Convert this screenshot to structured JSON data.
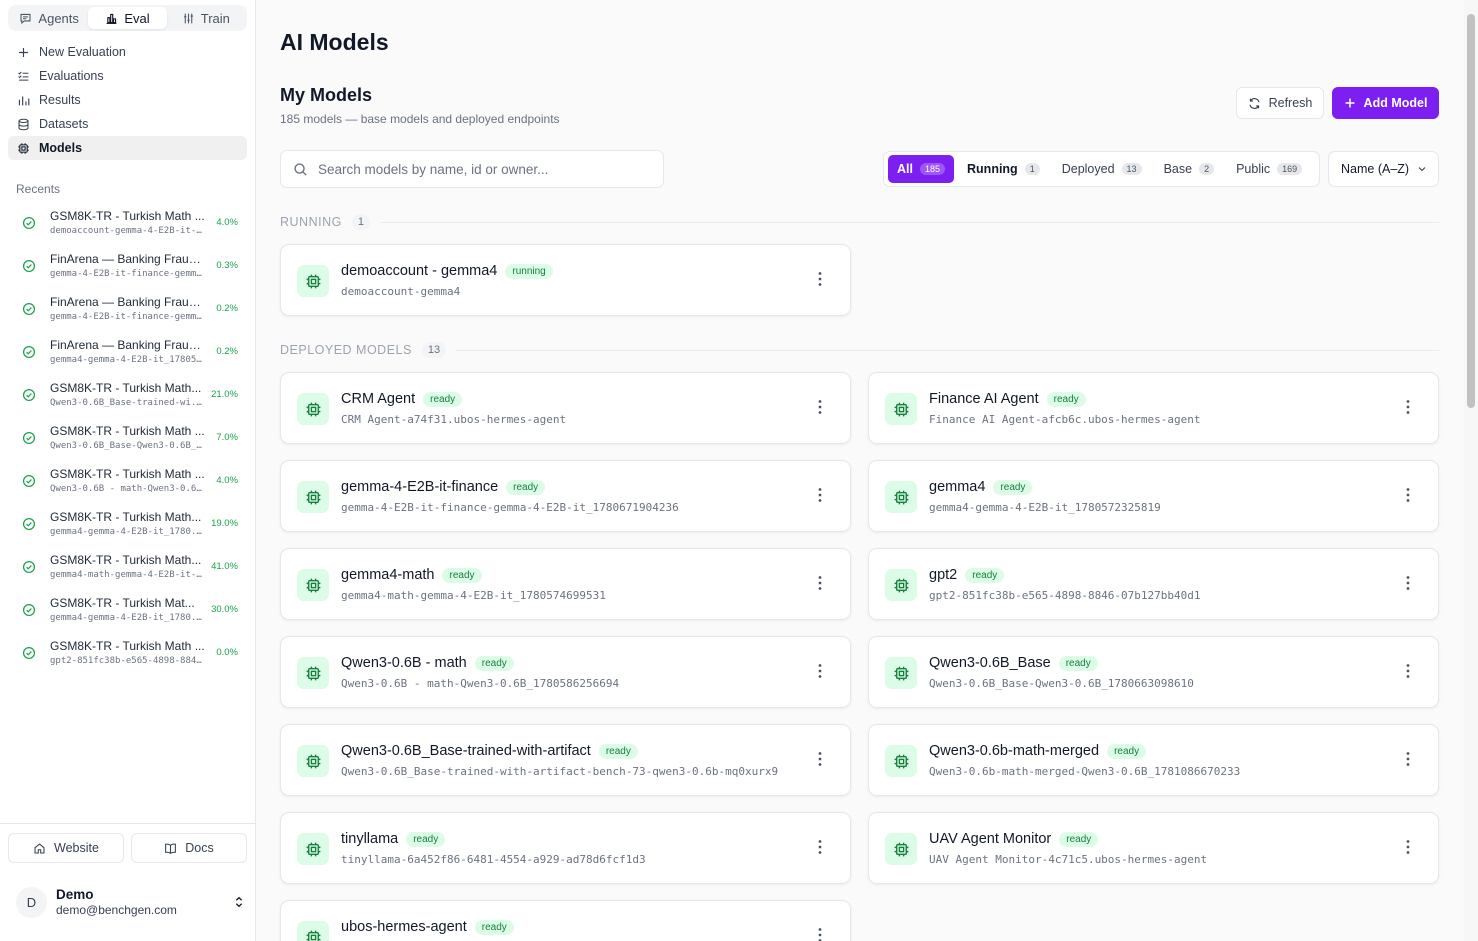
{
  "sidebar": {
    "tabs": [
      {
        "label": "Agents",
        "icon": "chat-icon"
      },
      {
        "label": "Eval",
        "icon": "bar-chart-icon",
        "active": true
      },
      {
        "label": "Train",
        "icon": "sliders-icon"
      }
    ],
    "nav": [
      {
        "label": "New Evaluation",
        "icon": "plus-icon"
      },
      {
        "label": "Evaluations",
        "icon": "list-check-icon"
      },
      {
        "label": "Results",
        "icon": "bar-chart-icon"
      },
      {
        "label": "Datasets",
        "icon": "database-icon"
      },
      {
        "label": "Models",
        "icon": "cpu-chip-icon",
        "active": true
      }
    ],
    "recents_title": "Recents",
    "recents": [
      {
        "title": "GSM8K-TR - Turkish Math ...",
        "sub": "demoaccount-gemma-4-E2B-it-...",
        "score": "4.0%"
      },
      {
        "title": "FinArena — Banking Fraud...",
        "sub": "gemma-4-E2B-it-finance-gemm...",
        "score": "0.3%"
      },
      {
        "title": "FinArena — Banking Fraud...",
        "sub": "gemma-4-E2B-it-finance-gemm...",
        "score": "0.2%"
      },
      {
        "title": "FinArena — Banking Fraud...",
        "sub": "gemma4-gemma-4-E2B-it_17805...",
        "score": "0.2%"
      },
      {
        "title": "GSM8K-TR - Turkish Math...",
        "sub": "Qwen3-0.6B_Base-trained-wi...",
        "score": "21.0%"
      },
      {
        "title": "GSM8K-TR - Turkish Math ...",
        "sub": "Qwen3-0.6B_Base-Qwen3-0.6B_...",
        "score": "7.0%"
      },
      {
        "title": "GSM8K-TR - Turkish Math ...",
        "sub": "Qwen3-0.6B - math-Qwen3-0.6...",
        "score": "4.0%"
      },
      {
        "title": "GSM8K-TR - Turkish Math...",
        "sub": "gemma4-gemma-4-E2B-it_1780...",
        "score": "19.0%"
      },
      {
        "title": "GSM8K-TR - Turkish Math...",
        "sub": "gemma4-math-gemma-4-E2B-it-...",
        "score": "41.0%"
      },
      {
        "title": "GSM8K-TR - Turkish Mat...",
        "sub": "gemma4-gemma-4-E2B-it_1780...",
        "score": "30.0%"
      },
      {
        "title": "GSM8K-TR - Turkish Math ...",
        "sub": "gpt2-851fc38b-e565-4898-884...",
        "score": "0.0%"
      }
    ],
    "website_label": "Website",
    "docs_label": "Docs",
    "user": {
      "initial": "D",
      "name": "Demo",
      "email": "demo@benchgen.com"
    }
  },
  "main": {
    "page_title": "AI Models",
    "section_title": "My Models",
    "section_subtitle": "185 models — base models and deployed endpoints",
    "refresh_label": "Refresh",
    "add_label": "Add Model",
    "search_placeholder": "Search models by name, id or owner...",
    "filters": [
      {
        "label": "All",
        "count": "185",
        "active": true
      },
      {
        "label": "Running",
        "count": "1"
      },
      {
        "label": "Deployed",
        "count": "13"
      },
      {
        "label": "Base",
        "count": "2"
      },
      {
        "label": "Public",
        "count": "169"
      }
    ],
    "sort_label": "Name (A–Z)",
    "running_group": {
      "label": "RUNNING",
      "count": "1",
      "models": [
        {
          "name": "demoaccount - gemma4",
          "status": "running",
          "id": "demoaccount-gemma4"
        }
      ]
    },
    "deployed_group": {
      "label": "DEPLOYED MODELS",
      "count": "13",
      "models": [
        {
          "name": "CRM Agent",
          "status": "ready",
          "id": "CRM Agent-a74f31.ubos-hermes-agent"
        },
        {
          "name": "Finance AI Agent",
          "status": "ready",
          "id": "Finance AI Agent-afcb6c.ubos-hermes-agent"
        },
        {
          "name": "gemma-4-E2B-it-finance",
          "status": "ready",
          "id": "gemma-4-E2B-it-finance-gemma-4-E2B-it_1780671904236"
        },
        {
          "name": "gemma4",
          "status": "ready",
          "id": "gemma4-gemma-4-E2B-it_1780572325819"
        },
        {
          "name": "gemma4-math",
          "status": "ready",
          "id": "gemma4-math-gemma-4-E2B-it_1780574699531"
        },
        {
          "name": "gpt2",
          "status": "ready",
          "id": "gpt2-851fc38b-e565-4898-8846-07b127bb40d1"
        },
        {
          "name": "Qwen3-0.6B - math",
          "status": "ready",
          "id": "Qwen3-0.6B - math-Qwen3-0.6B_1780586256694"
        },
        {
          "name": "Qwen3-0.6B_Base",
          "status": "ready",
          "id": "Qwen3-0.6B_Base-Qwen3-0.6B_1780663098610"
        },
        {
          "name": "Qwen3-0.6B_Base-trained-with-artifact",
          "status": "ready",
          "id": "Qwen3-0.6B_Base-trained-with-artifact-bench-73-qwen3-0.6b-mq0xurx9"
        },
        {
          "name": "Qwen3-0.6b-math-merged",
          "status": "ready",
          "id": "Qwen3-0.6b-math-merged-Qwen3-0.6B_1781086670233"
        },
        {
          "name": "tinyllama",
          "status": "ready",
          "id": "tinyllama-6a452f86-6481-4554-a929-ad78d6fcf1d3"
        },
        {
          "name": "UAV Agent Monitor",
          "status": "ready",
          "id": "UAV Agent Monitor-4c71c5.ubos-hermes-agent"
        },
        {
          "name": "ubos-hermes-agent",
          "status": "ready",
          "id": ""
        }
      ]
    }
  },
  "colors": {
    "accent": "#7c1ff0",
    "ready_bg": "#dcfce7",
    "ready_text": "#15803d",
    "score": "#16a34a"
  }
}
